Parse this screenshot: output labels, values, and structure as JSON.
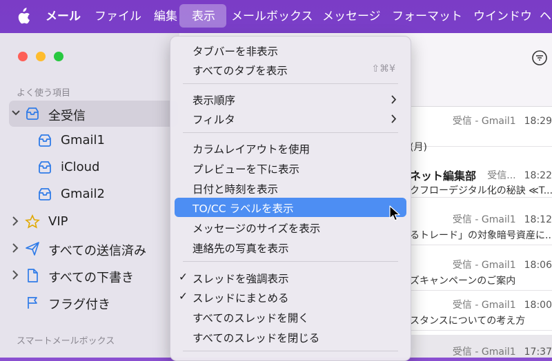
{
  "menubar": {
    "app_name": "メール",
    "items": [
      "ファイル",
      "編集",
      "表示",
      "メールボックス",
      "メッセージ",
      "フォーマット",
      "ウインドウ",
      "ヘ"
    ],
    "active_index": 2
  },
  "sidebar": {
    "section_favorites": "よく使う項目",
    "section_smart": "スマートメールボックス",
    "items": [
      {
        "label": "全受信",
        "icon": "inbox-icon"
      },
      {
        "label": "Gmail1",
        "icon": "inbox-icon"
      },
      {
        "label": "iCloud",
        "icon": "inbox-icon"
      },
      {
        "label": "Gmail2",
        "icon": "inbox-icon"
      },
      {
        "label": "VIP",
        "icon": "star-icon"
      },
      {
        "label": "すべての送信済み",
        "icon": "paper-plane-icon"
      },
      {
        "label": "すべての下書き",
        "icon": "document-icon"
      },
      {
        "label": "フラグ付き",
        "icon": "flag-icon"
      }
    ]
  },
  "messages": [
    {
      "mailbox": "受信 - Gmail1",
      "time": "18:29",
      "from": "",
      "subject": "(月)"
    },
    {
      "mailbox": "受信...",
      "time": "18:22",
      "from": "ネット編集部",
      "subject": "クフローデジタル化の秘訣 ≪T..."
    },
    {
      "mailbox": "受信 - Gmail1",
      "time": "18:12",
      "from": "",
      "subject": "るトレード」の対象暗号資産に..."
    },
    {
      "mailbox": "受信 - Gmail1",
      "time": "18:06",
      "from": "",
      "subject": "ズキャンペーンのご案内"
    },
    {
      "mailbox": "受信 - Gmail1",
      "time": "18:00",
      "from": "",
      "subject": "スタンスについての考え方"
    },
    {
      "mailbox": "受信 - Gmail1",
      "time": "17:37",
      "from": "",
      "subject": ""
    }
  ],
  "view_menu": {
    "groups": [
      [
        {
          "label": "タブバーを非表示"
        },
        {
          "label": "すべてのタブを表示",
          "shortcut": "⇧⌘¥"
        }
      ],
      [
        {
          "label": "表示順序",
          "submenu": true
        },
        {
          "label": "フィルタ",
          "submenu": true
        }
      ],
      [
        {
          "label": "カラムレイアウトを使用"
        },
        {
          "label": "プレビューを下に表示"
        },
        {
          "label": "日付と時刻を表示"
        },
        {
          "label": "TO/CC ラベルを表示",
          "highlighted": true
        },
        {
          "label": "メッセージのサイズを表示"
        },
        {
          "label": "連絡先の写真を表示"
        }
      ],
      [
        {
          "label": "スレッドを強調表示",
          "checked": true
        },
        {
          "label": "スレッドにまとめる",
          "checked": true
        },
        {
          "label": "すべてのスレッドを開く"
        },
        {
          "label": "すべてのスレッドを閉じる"
        }
      ]
    ],
    "check_glyph": "✓"
  },
  "colors": {
    "menubar": "#7b3cc6",
    "highlight": "#4d8ef3",
    "sidebar": "#e6e3ec"
  }
}
